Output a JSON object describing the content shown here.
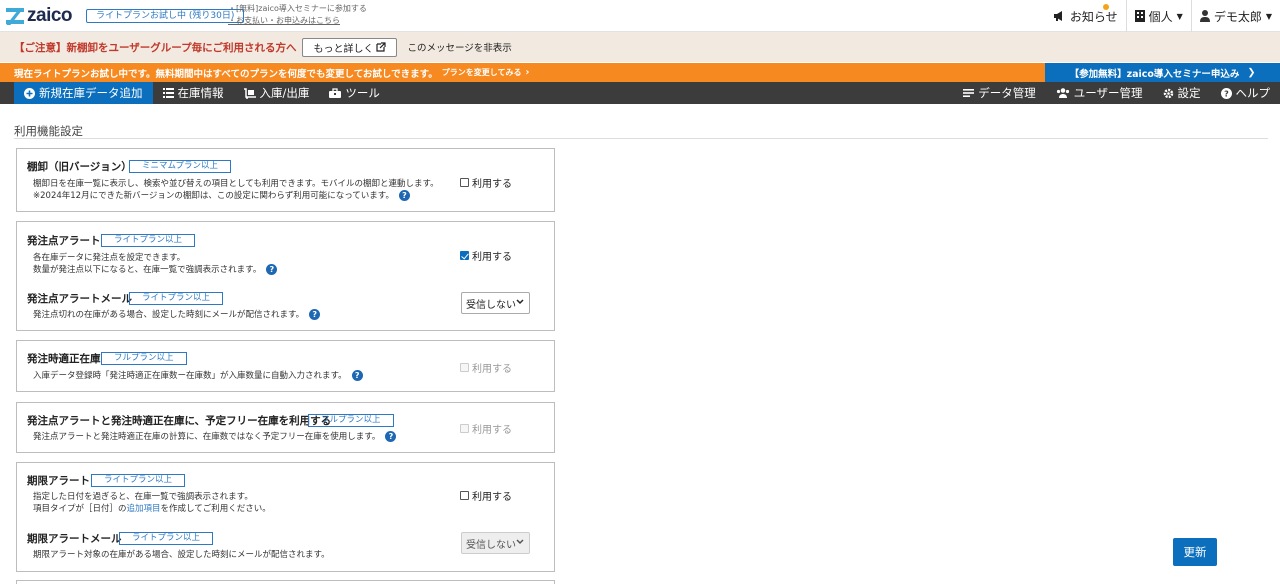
{
  "header": {
    "logo_text": "zaico",
    "trial_badge": "ライトプランお試し中 (残り30日)",
    "seminar_line1": "・[無料]zaico導入セミナーに参加する",
    "seminar_line2": "・お支払い・お申込みはこちら",
    "notifications_label": "お知らせ",
    "account_type_label": "個人",
    "user_label": "デモ太郎"
  },
  "notice": {
    "text": "【ご注意】新棚卸をユーザーグループ毎にご利用される方へ",
    "more_button": "もっと詳しく",
    "hide_message": "このメッセージを非表示"
  },
  "promo": {
    "text": "現在ライトプランお試し中です。無料期間中はすべてのプランを何度でも変更してお試しできます。",
    "link": "プランを変更してみる",
    "seminar_button": "【参加無料】zaico導入セミナー申込み"
  },
  "nav": {
    "left": [
      "新規在庫データ追加",
      "在庫情報",
      "入庫/出庫",
      "ツール"
    ],
    "right": [
      "データ管理",
      "ユーザー管理",
      "設定",
      "ヘルプ"
    ]
  },
  "page": {
    "title": "利用機能設定",
    "update_button": "更新"
  },
  "settings": {
    "stocktake": {
      "title": "棚卸（旧バージョン）",
      "plan": "ミニマムプラン以上",
      "desc1": "棚卸日を在庫一覧に表示し、検索や並び替えの項目としても利用できます。モバイルの棚卸と連動します。",
      "desc2": "※2024年12月にできた新バージョンの棚卸は、この設定に関わらず利用可能になっています。",
      "checkbox": "利用する",
      "checked": false
    },
    "order_alert": {
      "title": "発注点アラート",
      "plan": "ライトプラン以上",
      "desc1": "各在庫データに発注点を設定できます。",
      "desc2": "数量が発注点以下になると、在庫一覧で強調表示されます。",
      "checkbox": "利用する",
      "checked": true
    },
    "order_alert_mail": {
      "title": "発注点アラートメール",
      "plan": "ライトプラン以上",
      "desc": "発注点切れの在庫がある場合、設定した時刻にメールが配信されます。",
      "select": "受信しない"
    },
    "proper_stock": {
      "title": "発注時適正在庫",
      "plan": "フルプラン以上",
      "desc": "入庫データ登録時「発注時適正在庫数ー在庫数」が入庫数量に自動入力されます。",
      "checkbox": "利用する",
      "checked": false
    },
    "free_stock": {
      "title": "発注点アラートと発注時適正在庫に、予定フリー在庫を利用する",
      "plan": "フルプラン以上",
      "desc": "発注点アラートと発注時適正在庫の計算に、在庫数ではなく予定フリー在庫を使用します。",
      "checkbox": "利用する",
      "checked": false
    },
    "expiry_alert": {
      "title": "期限アラート",
      "plan": "ライトプラン以上",
      "desc1": "指定した日付を過ぎると、在庫一覧で強調表示されます。",
      "desc2_a": "項目タイプが［日付］の",
      "desc2_link": "追加項目",
      "desc2_b": "を作成してご利用ください。",
      "checkbox": "利用する",
      "checked": false
    },
    "expiry_alert_mail": {
      "title": "期限アラートメール",
      "plan": "ライトプラン以上",
      "desc": "期限アラート対象の在庫がある場合、設定した時刻にメールが配信されます。",
      "select": "受信しない"
    }
  },
  "colors": {
    "brand_blue": "#0b6fbd",
    "orange": "#f6891f",
    "nav_dark": "#3c3c3c",
    "warning_red": "#c0392b"
  }
}
